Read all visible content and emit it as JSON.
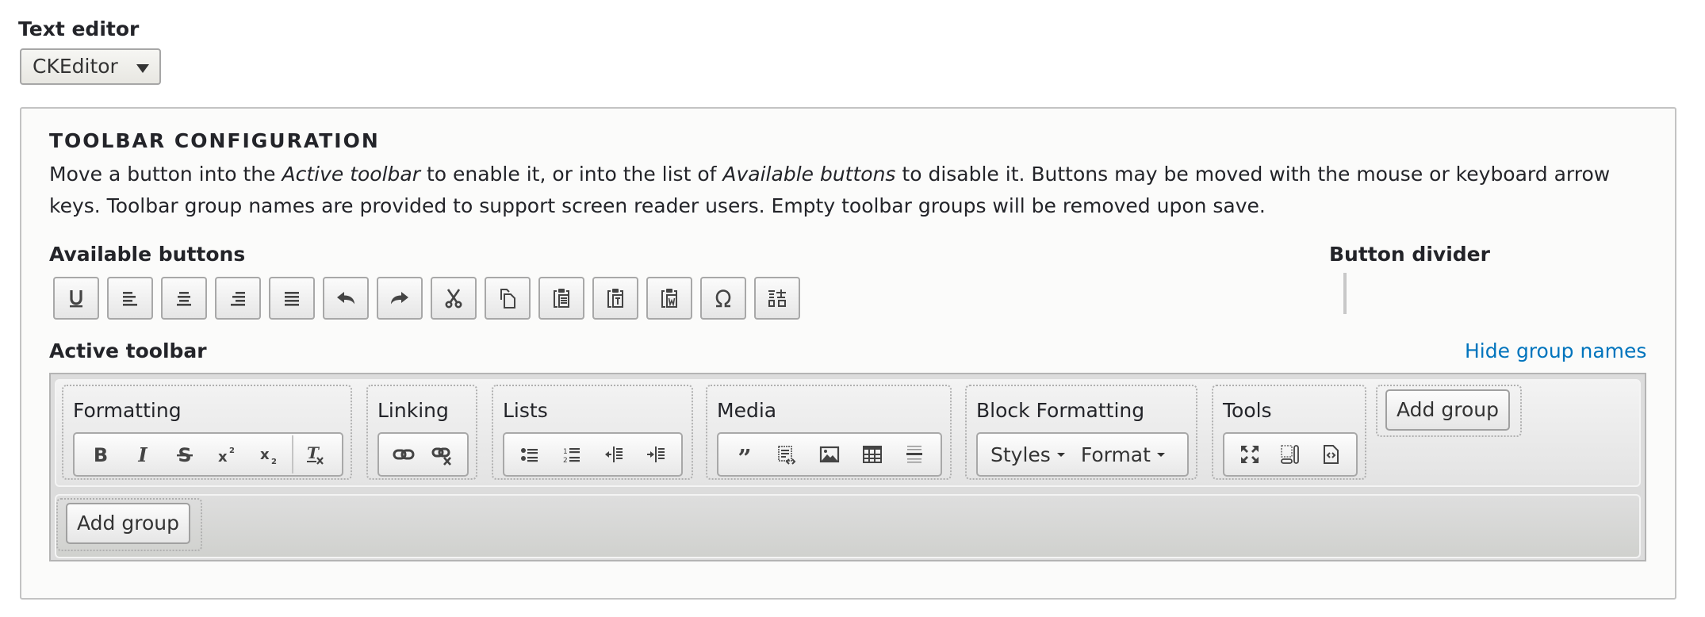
{
  "text_editor": {
    "label": "Text editor",
    "selected": "CKEditor"
  },
  "config": {
    "title": "TOOLBAR CONFIGURATION",
    "desc_parts": [
      "Move a button into the ",
      "Active toolbar",
      " to enable it, or into the list of ",
      "Available buttons",
      " to disable it. Buttons may be moved with the mouse or keyboard arrow keys. Toolbar group names are provided to support screen reader users. Empty toolbar groups will be removed upon save."
    ]
  },
  "available": {
    "label": "Available buttons",
    "buttons": [
      {
        "name": "underline",
        "icon": "underline-icon"
      },
      {
        "name": "align-left",
        "icon": "align-left-icon"
      },
      {
        "name": "align-center",
        "icon": "align-center-icon"
      },
      {
        "name": "align-right",
        "icon": "align-right-icon"
      },
      {
        "name": "justify",
        "icon": "justify-icon"
      },
      {
        "name": "undo",
        "icon": "undo-icon"
      },
      {
        "name": "redo",
        "icon": "redo-icon"
      },
      {
        "name": "cut",
        "icon": "scissors-icon"
      },
      {
        "name": "copy",
        "icon": "copy-icon"
      },
      {
        "name": "paste",
        "icon": "paste-icon"
      },
      {
        "name": "paste-text",
        "icon": "paste-text-icon"
      },
      {
        "name": "paste-from-word",
        "icon": "paste-word-icon"
      },
      {
        "name": "special-character",
        "icon": "omega-icon"
      },
      {
        "name": "language",
        "icon": "language-icon"
      }
    ]
  },
  "divider": {
    "label": "Button divider"
  },
  "active": {
    "label": "Active toolbar",
    "hide_group_names": "Hide group names",
    "add_group": "Add group",
    "groups": [
      {
        "name": "Formatting",
        "buttons": [
          "bold",
          "italic",
          "strike",
          "superscript",
          "subscript",
          "|",
          "remove-format"
        ]
      },
      {
        "name": "Linking",
        "buttons": [
          "link",
          "unlink"
        ]
      },
      {
        "name": "Lists",
        "buttons": [
          "bulleted-list",
          "numbered-list",
          "outdent",
          "indent"
        ]
      },
      {
        "name": "Media",
        "buttons": [
          "blockquote",
          "insert-code",
          "image",
          "table",
          "horizontal-line"
        ]
      },
      {
        "name": "Block Formatting",
        "combos": [
          "Styles",
          "Format"
        ]
      },
      {
        "name": "Tools",
        "buttons": [
          "maximize",
          "show-blocks",
          "source"
        ]
      }
    ]
  },
  "colors": {
    "link": "#0074bd",
    "icon": "#444444"
  }
}
